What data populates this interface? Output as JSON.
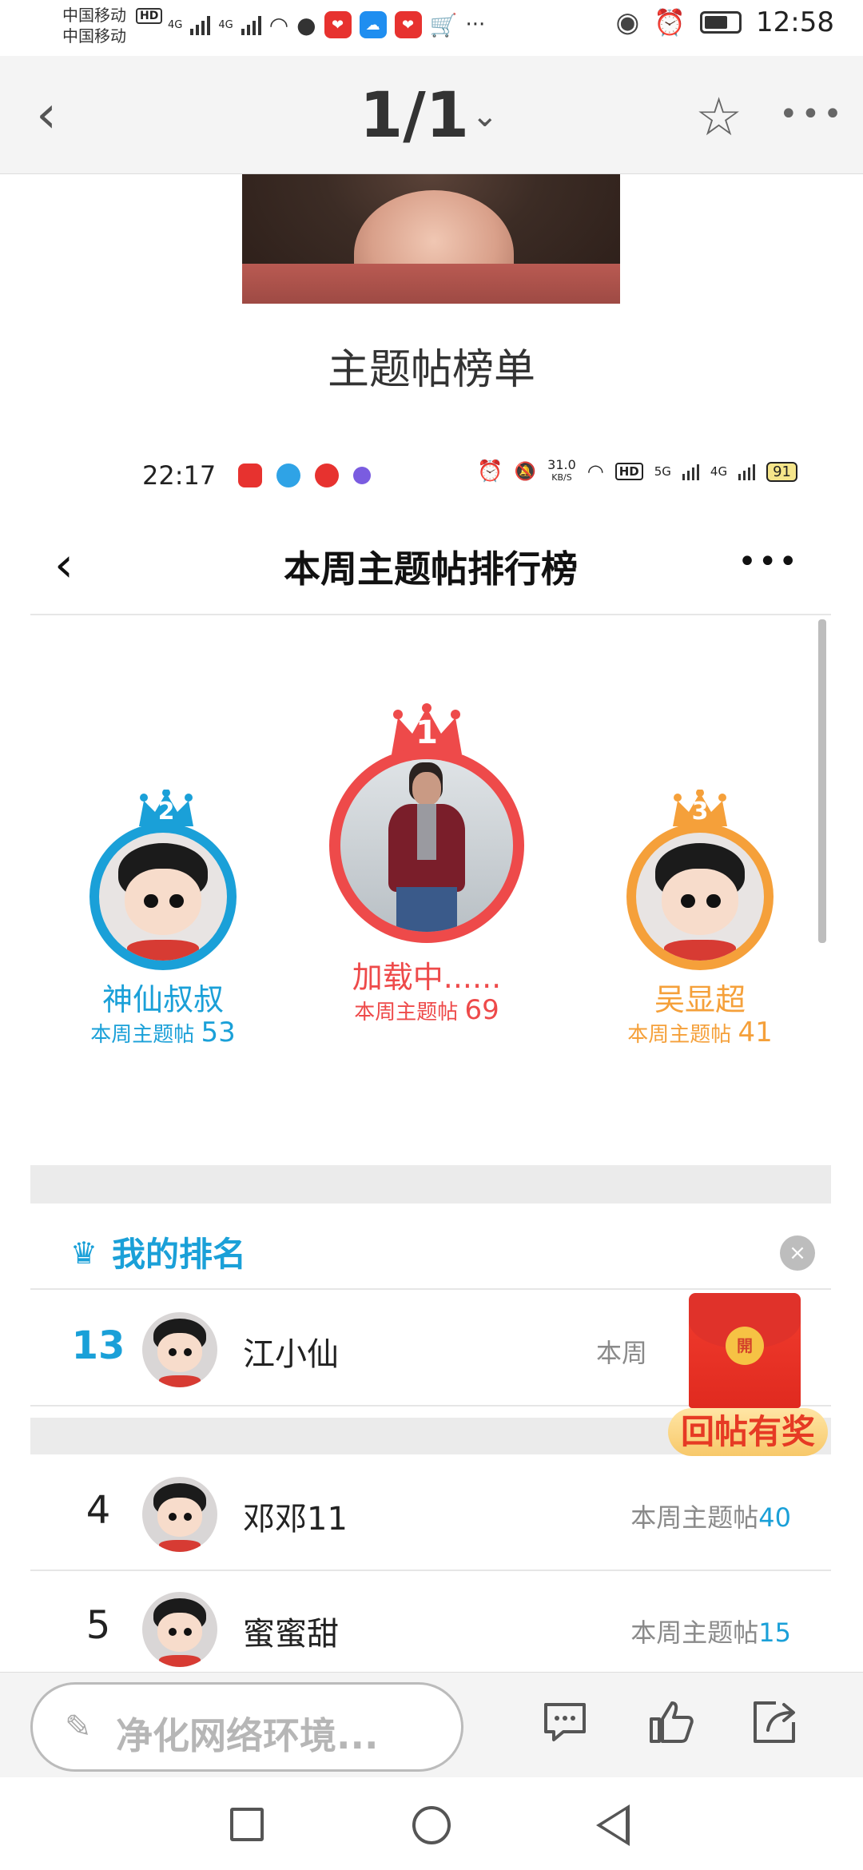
{
  "status_bar": {
    "carrier_1": "中国移动",
    "carrier_2": "中国移动",
    "hd": "HD",
    "net_1": "4G",
    "net_2": "4G",
    "more": "···",
    "time": "12:58"
  },
  "top_nav": {
    "pager": "1/1",
    "pager_arrow": "⌄",
    "back_icon": "chevron-left-icon",
    "star_icon": "star-icon",
    "more_icon": "more-dots-icon",
    "more_label": "•••"
  },
  "post": {
    "section_title": "主题帖榜单"
  },
  "inner_status_bar": {
    "time": "22:17",
    "speed_value": "31.0",
    "speed_unit": "KB/S",
    "net_5g": "5G",
    "net_4g": "4G",
    "hd": "HD",
    "battery": "91"
  },
  "inner_nav": {
    "title": "本周主题帖排行榜",
    "back": "‹",
    "more": "•••"
  },
  "podium": {
    "first": {
      "rank": "1",
      "name": "加载中......",
      "label": "本周主题帖",
      "count": "69",
      "color": "#ee4a4a"
    },
    "second": {
      "rank": "2",
      "name": "神仙叔叔",
      "label": "本周主题帖",
      "count": "53",
      "color": "#1aa0d8"
    },
    "third": {
      "rank": "3",
      "name": "吴显超",
      "label": "本周主题帖",
      "count": "41",
      "color": "#f5a03a"
    }
  },
  "my_rank": {
    "title": "我的排名",
    "close": "×",
    "row": {
      "rank": "13",
      "name": "江小仙",
      "label": "本周"
    }
  },
  "ranking": [
    {
      "rank": "4",
      "name": "邓邓11",
      "label": "本周主题帖",
      "count": "40"
    },
    {
      "rank": "5",
      "name": "蜜蜜甜",
      "label": "本周主题帖",
      "count": "15"
    }
  ],
  "red_packet": {
    "coin": "開",
    "label": "回帖有奖"
  },
  "bottom_bar": {
    "placeholder": "净化网络环境...",
    "pen": "✎",
    "comment_icon": "comment-icon",
    "like_icon": "thumbs-up-icon",
    "share_icon": "share-icon"
  },
  "colors": {
    "accent_blue": "#1aa0d8",
    "rank1_red": "#ee4a4a",
    "rank3_orange": "#f5a03a"
  }
}
